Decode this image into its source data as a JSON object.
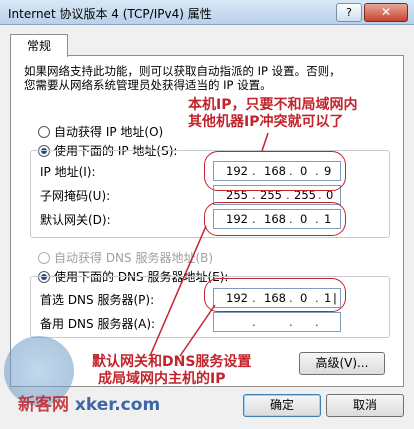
{
  "window": {
    "title": "Internet 协议版本 4 (TCP/IPv4) 属性",
    "help": "?",
    "close": "✕"
  },
  "tab": "常规",
  "intro": [
    "如果网络支持此功能，则可以获取自动指派的 IP 设置。否则，",
    "您需要从网络系统管理员处获得适当的 IP 设置。"
  ],
  "ip_mode": {
    "auto_label": "自动获得 IP 地址(O)",
    "manual_label": "使用下面的 IP 地址(S):",
    "selected": "manual"
  },
  "ip_fields": {
    "ip": {
      "label": "IP 地址(I):",
      "octets": [
        "192",
        "168",
        "0",
        "9"
      ]
    },
    "mask": {
      "label": "子网掩码(U):",
      "octets": [
        "255",
        "255",
        "255",
        "0"
      ]
    },
    "gateway": {
      "label": "默认网关(D):",
      "octets": [
        "192",
        "168",
        "0",
        "1"
      ]
    }
  },
  "dns_mode": {
    "auto_label": "自动获得 DNS 服务器地址(B)",
    "manual_label": "使用下面的 DNS 服务器地址(E):",
    "selected": "manual"
  },
  "dns_fields": {
    "preferred": {
      "label": "首选 DNS 服务器(P):",
      "octets": [
        "192",
        "168",
        "0",
        "1"
      ]
    },
    "alternate": {
      "label": "备用 DNS 服务器(A):",
      "octets": [
        "",
        "",
        "",
        ""
      ]
    }
  },
  "advanced_button": "高级(V)...",
  "ok_button": "确定",
  "cancel_button": "取消",
  "annotations": {
    "top": [
      "本机IP，只要不和局域网内",
      "其他机器IP冲突就可以了"
    ],
    "bottom": [
      "默认网关和DNS服务设置",
      "成局域网内主机的IP"
    ]
  },
  "watermark": {
    "brand": "新客网",
    "domain": "xker.com"
  },
  "colors": {
    "annotation": "#c3232b",
    "radio_selected": "#1c4a8f"
  }
}
